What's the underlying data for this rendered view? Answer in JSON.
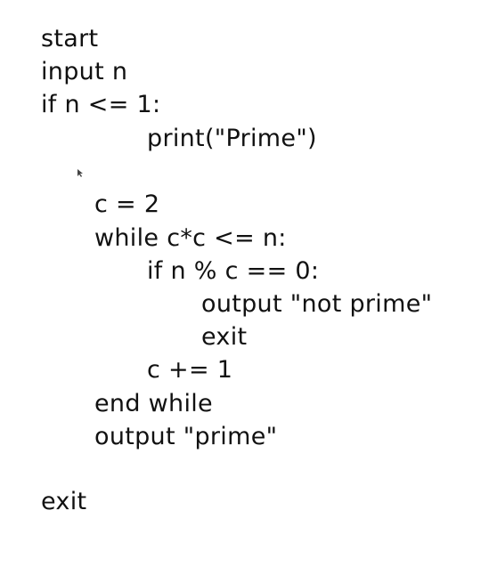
{
  "pseudocode": {
    "lines": [
      "start",
      "input n",
      "if n <= 1:",
      "print(\"Prime\")",
      "c = 2",
      "while c*c <= n:",
      "if n % c == 0:",
      "output \"not prime\"",
      "exit",
      "c += 1",
      "end while",
      "output \"prime\"",
      "exit"
    ]
  },
  "colors": {
    "ink": "#111111",
    "background": "#ffffff"
  },
  "icons": {
    "cursor": "mouse-pointer-icon"
  }
}
